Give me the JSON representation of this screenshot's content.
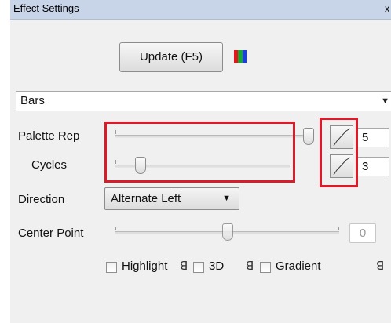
{
  "window": {
    "title": "Effect Settings",
    "close_glyph": "x"
  },
  "toolbar": {
    "update_label": "Update (F5)",
    "color_icon": "color-palette-icon",
    "color_bars": [
      "#e8141b",
      "#18a82f",
      "#1b3fd8"
    ]
  },
  "effect_select": {
    "value": "Bars",
    "arrow": "▼"
  },
  "palette_rep": {
    "label": "Palette Rep",
    "value": "5"
  },
  "cycles": {
    "label": "Cycles",
    "value": "3"
  },
  "direction": {
    "label": "Direction",
    "value": "Alternate Left",
    "arrow": "▼"
  },
  "center_point": {
    "label": "Center Point",
    "value": "0"
  },
  "checkboxes": [
    {
      "label": "Highlight",
      "checked": false
    },
    {
      "label": "3D",
      "checked": false
    },
    {
      "label": "Gradient",
      "checked": false
    }
  ],
  "lock_glyph": "ꓭ",
  "colors": {
    "highlight_outline": "#d91c29",
    "titlebar": "#c8d4e8",
    "panel": "#f0f0f0"
  }
}
